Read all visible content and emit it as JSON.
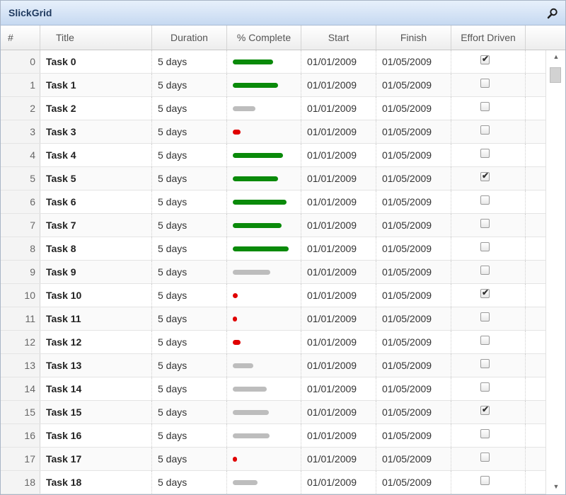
{
  "titlebar": {
    "title": "SlickGrid",
    "search_icon": "search-icon"
  },
  "columns": [
    "#",
    "Title",
    "Duration",
    "% Complete",
    "Start",
    "Finish",
    "Effort Driven"
  ],
  "colors": {
    "high": "#0a8a0a",
    "mid": "#bdbdbd",
    "low": "#e00000"
  },
  "rows": [
    {
      "id": "0",
      "title": "Task 0",
      "duration": "5 days",
      "percent": 62,
      "status": "high",
      "start": "01/01/2009",
      "finish": "01/05/2009",
      "effort": true
    },
    {
      "id": "1",
      "title": "Task 1",
      "duration": "5 days",
      "percent": 70,
      "status": "high",
      "start": "01/01/2009",
      "finish": "01/05/2009",
      "effort": false
    },
    {
      "id": "2",
      "title": "Task 2",
      "duration": "5 days",
      "percent": 35,
      "status": "mid",
      "start": "01/01/2009",
      "finish": "01/05/2009",
      "effort": false
    },
    {
      "id": "3",
      "title": "Task 3",
      "duration": "5 days",
      "percent": 12,
      "status": "low",
      "start": "01/01/2009",
      "finish": "01/05/2009",
      "effort": false
    },
    {
      "id": "4",
      "title": "Task 4",
      "duration": "5 days",
      "percent": 77,
      "status": "high",
      "start": "01/01/2009",
      "finish": "01/05/2009",
      "effort": false
    },
    {
      "id": "5",
      "title": "Task 5",
      "duration": "5 days",
      "percent": 70,
      "status": "high",
      "start": "01/01/2009",
      "finish": "01/05/2009",
      "effort": true
    },
    {
      "id": "6",
      "title": "Task 6",
      "duration": "5 days",
      "percent": 83,
      "status": "high",
      "start": "01/01/2009",
      "finish": "01/05/2009",
      "effort": false
    },
    {
      "id": "7",
      "title": "Task 7",
      "duration": "5 days",
      "percent": 75,
      "status": "high",
      "start": "01/01/2009",
      "finish": "01/05/2009",
      "effort": false
    },
    {
      "id": "8",
      "title": "Task 8",
      "duration": "5 days",
      "percent": 86,
      "status": "high",
      "start": "01/01/2009",
      "finish": "01/05/2009",
      "effort": false
    },
    {
      "id": "9",
      "title": "Task 9",
      "duration": "5 days",
      "percent": 58,
      "status": "mid",
      "start": "01/01/2009",
      "finish": "01/05/2009",
      "effort": false
    },
    {
      "id": "10",
      "title": "Task 10",
      "duration": "5 days",
      "percent": 8,
      "status": "low",
      "start": "01/01/2009",
      "finish": "01/05/2009",
      "effort": true
    },
    {
      "id": "11",
      "title": "Task 11",
      "duration": "5 days",
      "percent": 5,
      "status": "low",
      "start": "01/01/2009",
      "finish": "01/05/2009",
      "effort": false
    },
    {
      "id": "12",
      "title": "Task 12",
      "duration": "5 days",
      "percent": 12,
      "status": "low",
      "start": "01/01/2009",
      "finish": "01/05/2009",
      "effort": false
    },
    {
      "id": "13",
      "title": "Task 13",
      "duration": "5 days",
      "percent": 32,
      "status": "mid",
      "start": "01/01/2009",
      "finish": "01/05/2009",
      "effort": false
    },
    {
      "id": "14",
      "title": "Task 14",
      "duration": "5 days",
      "percent": 52,
      "status": "mid",
      "start": "01/01/2009",
      "finish": "01/05/2009",
      "effort": false
    },
    {
      "id": "15",
      "title": "Task 15",
      "duration": "5 days",
      "percent": 55,
      "status": "mid",
      "start": "01/01/2009",
      "finish": "01/05/2009",
      "effort": true
    },
    {
      "id": "16",
      "title": "Task 16",
      "duration": "5 days",
      "percent": 57,
      "status": "mid",
      "start": "01/01/2009",
      "finish": "01/05/2009",
      "effort": false
    },
    {
      "id": "17",
      "title": "Task 17",
      "duration": "5 days",
      "percent": 7,
      "status": "low",
      "start": "01/01/2009",
      "finish": "01/05/2009",
      "effort": false
    },
    {
      "id": "18",
      "title": "Task 18",
      "duration": "5 days",
      "percent": 38,
      "status": "mid",
      "start": "01/01/2009",
      "finish": "01/05/2009",
      "effort": false
    }
  ]
}
